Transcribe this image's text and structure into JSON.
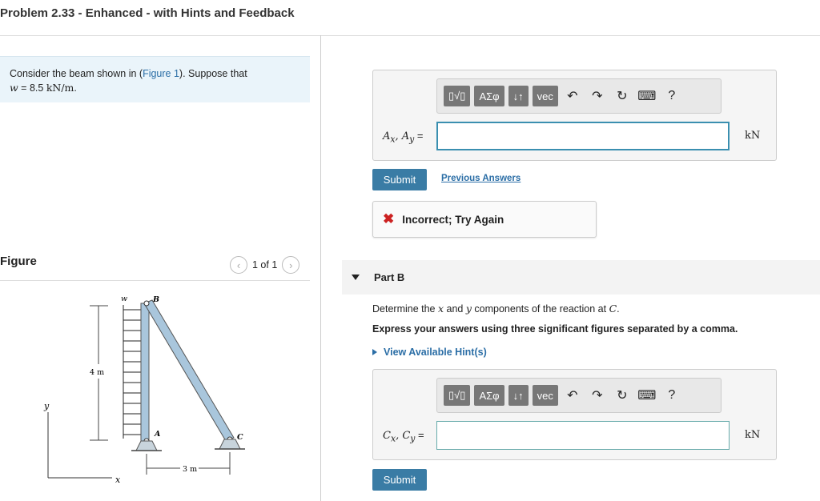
{
  "header": {
    "title": "Problem 2.33 - Enhanced - with Hints and Feedback"
  },
  "problem": {
    "prefix": "Consider the beam shown in (",
    "figure_link": "Figure 1",
    "suffix": "). Suppose that",
    "w_var": "w",
    "w_value": " = 8.5 ",
    "w_unit": "kN/m",
    "period": "."
  },
  "figure": {
    "title": "Figure",
    "counter": "1 of 1",
    "labels": {
      "w": "w",
      "B": "B",
      "A": "A",
      "C": "C",
      "height": "4 m",
      "width": "3 m",
      "y": "y",
      "x": "x"
    }
  },
  "toolbar": {
    "templates": "▯√▯",
    "greek": "ΑΣφ",
    "arrows": "↓↑",
    "vec": "vec",
    "help": "?"
  },
  "partA": {
    "label_main": "A",
    "label_sub1": "x",
    "label_sep": ", ",
    "label_sub2": "y",
    "label_eq": " =",
    "input_value": "",
    "unit": "kN",
    "submit": "Submit",
    "previous_answers": "Previous Answers",
    "feedback": "Incorrect; Try Again"
  },
  "partB": {
    "label": "Part B",
    "determine_1": "Determine the ",
    "x_var": "x",
    "determine_2": " and ",
    "y_var": "y",
    "determine_3": " components of the reaction at ",
    "c_var": "C",
    "determine_4": ".",
    "express": "Express your answers using three significant figures separated by a comma.",
    "hints": "View Available Hint(s)",
    "label_main": "C",
    "label_sub1": "x",
    "label_sep": ", ",
    "label_sub2": "y",
    "label_eq": " =",
    "input_value": "",
    "unit": "kN",
    "submit": "Submit"
  }
}
